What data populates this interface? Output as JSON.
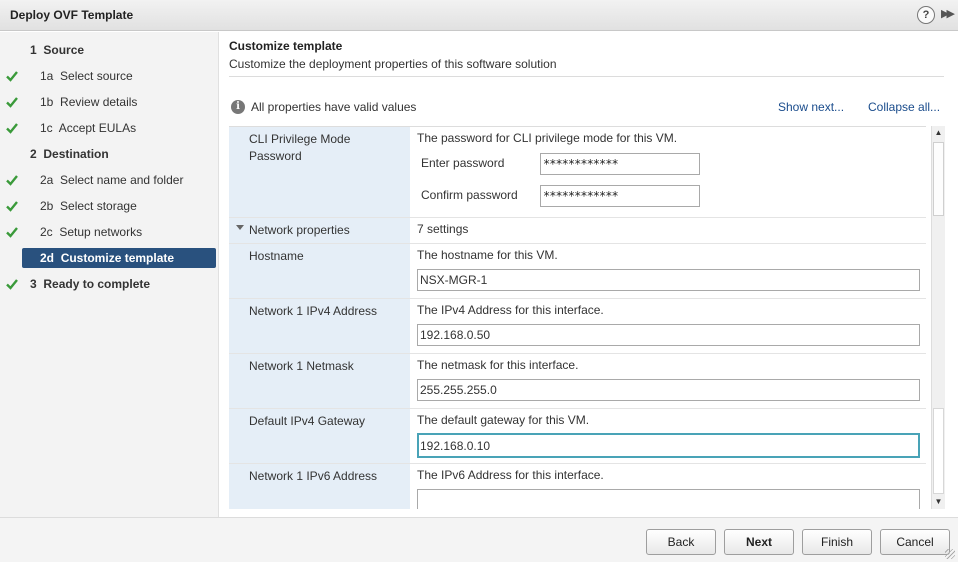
{
  "window": {
    "title": "Deploy OVF Template",
    "help_glyph": "?",
    "expand_glyph": "▶▶"
  },
  "steps": [
    {
      "num": "1",
      "label": "Source",
      "checked": false,
      "level": "top",
      "active": false
    },
    {
      "num": "1a",
      "label": "Select source",
      "checked": true,
      "level": "sub",
      "active": false
    },
    {
      "num": "1b",
      "label": "Review details",
      "checked": true,
      "level": "sub",
      "active": false
    },
    {
      "num": "1c",
      "label": "Accept EULAs",
      "checked": true,
      "level": "sub",
      "active": false
    },
    {
      "num": "2",
      "label": "Destination",
      "checked": false,
      "level": "top",
      "active": false
    },
    {
      "num": "2a",
      "label": "Select name and folder",
      "checked": true,
      "level": "sub",
      "active": false
    },
    {
      "num": "2b",
      "label": "Select storage",
      "checked": true,
      "level": "sub",
      "active": false
    },
    {
      "num": "2c",
      "label": "Setup networks",
      "checked": true,
      "level": "sub",
      "active": false
    },
    {
      "num": "2d",
      "label": "Customize template",
      "checked": false,
      "level": "sub",
      "active": true
    },
    {
      "num": "3",
      "label": "Ready to complete",
      "checked": true,
      "level": "top",
      "active": false
    }
  ],
  "main": {
    "heading": "Customize template",
    "subheading": "Customize the deployment properties of this software solution",
    "info_text": "All properties have valid values",
    "show_next": "Show next...",
    "collapse_all": "Collapse all..."
  },
  "properties": {
    "cli": {
      "label": "CLI Privilege Mode Password",
      "description": "The password for CLI privilege mode for this VM.",
      "enter_label": "Enter password",
      "enter_value": "************",
      "confirm_label": "Confirm password",
      "confirm_value": "************"
    },
    "network_group": {
      "label": "Network properties",
      "count": "7 settings"
    },
    "hostname": {
      "label": "Hostname",
      "description": "The hostname for this VM.",
      "value": "NSX-MGR-1"
    },
    "ipv4": {
      "label": "Network 1 IPv4 Address",
      "description": "The IPv4 Address for this interface.",
      "value": "192.168.0.50"
    },
    "netmask": {
      "label": "Network 1 Netmask",
      "description": "The netmask for this interface.",
      "value": "255.255.255.0"
    },
    "gateway": {
      "label": "Default IPv4 Gateway",
      "description": "The default gateway for this VM.",
      "value": "192.168.0.10"
    },
    "ipv6": {
      "label": "Network 1 IPv6 Address",
      "description": "The IPv6 Address for this interface.",
      "value": ""
    }
  },
  "footer": {
    "back": "Back",
    "next": "Next",
    "finish": "Finish",
    "cancel": "Cancel"
  },
  "colors": {
    "active_step": "#29517e",
    "check": "#3a9a3a",
    "label_bg": "#e5eef7",
    "focus_border": "#49a3b7",
    "link": "#1a4c8c"
  }
}
